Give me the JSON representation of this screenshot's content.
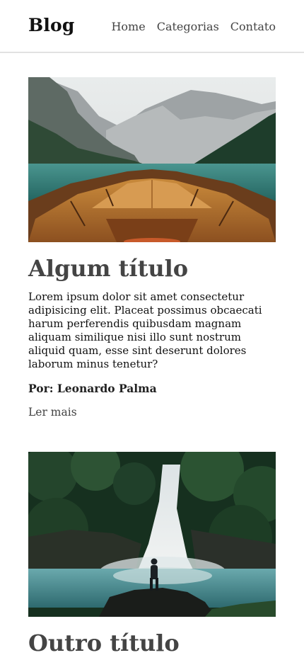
{
  "header": {
    "brand": "Blog",
    "nav": [
      "Home",
      "Categorias",
      "Contato"
    ]
  },
  "posts": [
    {
      "title": "Algum título",
      "body": "Lorem ipsum dolor sit amet consectetur adipisicing elit. Placeat possimus obcaecati harum perferendis quibusdam magnam aliquam similique nisi illo sunt nostrum aliquid quam, esse sint deserunt dolores laborum minus tenetur?",
      "author": "Por: Leonardo Palma",
      "read_more": "Ler mais",
      "image": "boat-on-mountain-lake-photo"
    },
    {
      "title": "Outro título",
      "image": "waterfall-with-hiker-photo"
    }
  ]
}
